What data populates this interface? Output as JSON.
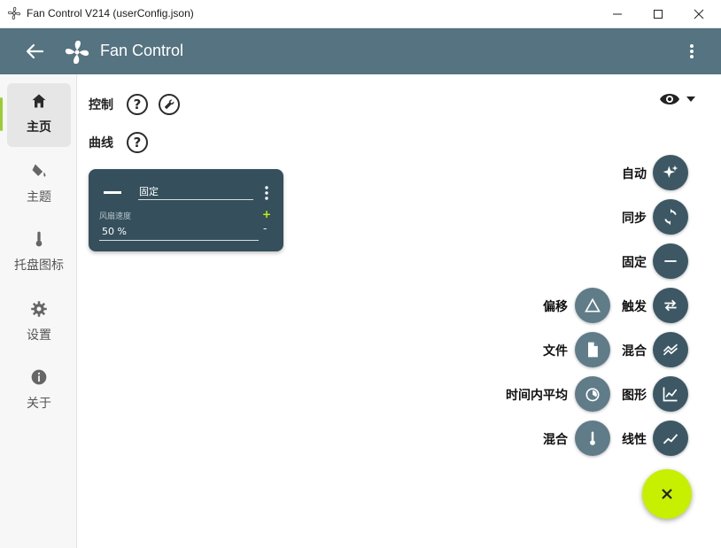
{
  "window": {
    "title": "Fan Control V214 (userConfig.json)"
  },
  "appbar": {
    "title": "Fan Control"
  },
  "sidebar": {
    "items": [
      {
        "label": "主页",
        "icon": "home-icon"
      },
      {
        "label": "主题",
        "icon": "paint-bucket-icon"
      },
      {
        "label": "托盘图标",
        "icon": "thermometer-icon"
      },
      {
        "label": "设置",
        "icon": "gear-icon"
      },
      {
        "label": "关于",
        "icon": "info-icon"
      }
    ]
  },
  "main": {
    "controls_label": "控制",
    "curves_label": "曲线",
    "help_glyph": "?"
  },
  "card": {
    "name": "固定",
    "field_label": "风扇速度",
    "value": "50 %",
    "plus": "+",
    "minus": "-"
  },
  "fab_menu": {
    "right": [
      "自动",
      "同步",
      "固定",
      "触发",
      "混合",
      "图形",
      "线性"
    ],
    "left": [
      "偏移",
      "文件",
      "时间内平均",
      "混合"
    ]
  },
  "colors": {
    "appbar": "#557380",
    "card": "#35505c",
    "accent": "#c6f000",
    "active_indicator": "#9acd32"
  }
}
